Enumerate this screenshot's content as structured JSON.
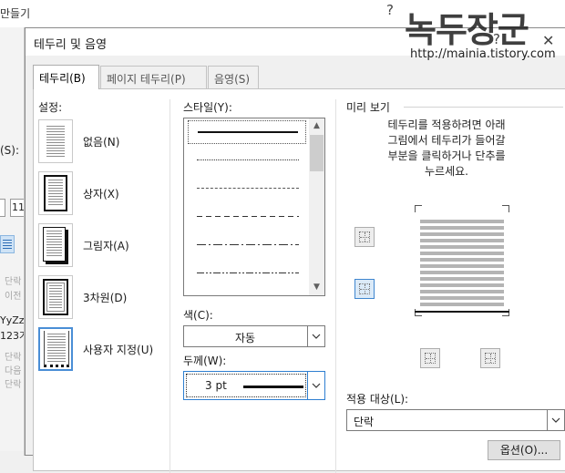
{
  "background": {
    "title": "만들기",
    "help": "?",
    "label_s": "(S):",
    "box_text": "11",
    "faint_lines": [
      "단락",
      "이전",
      "YyZz",
      "123가",
      "단락",
      "다음",
      "단락"
    ]
  },
  "watermark": {
    "title": "녹두장군",
    "url": "http://mainia.tistory.com"
  },
  "dialog": {
    "title": "테두리 및 음영",
    "help": "?",
    "close": "✕",
    "tabs": [
      {
        "label": "테두리(B)",
        "active": true
      },
      {
        "label": "페이지 테두리(P)",
        "active": false
      },
      {
        "label": "음영(S)",
        "active": false
      }
    ],
    "setting": {
      "label": "설정:",
      "items": [
        {
          "label": "없음(N)"
        },
        {
          "label": "상자(X)"
        },
        {
          "label": "그림자(A)"
        },
        {
          "label": "3차원(D)"
        },
        {
          "label": "사용자 지정(U)",
          "selected": true
        }
      ]
    },
    "style": {
      "label": "스타일(Y):",
      "lines": [
        "solid",
        "dotted",
        "dashed-fine",
        "dashed",
        "dash-dot",
        "dash-dot-dot"
      ]
    },
    "color": {
      "label": "색(C):",
      "value": "자동"
    },
    "width": {
      "label": "두께(W):",
      "value": "3 pt"
    },
    "preview": {
      "label": "미리 보기",
      "instructions": "테두리를 적용하려면 아래\n그림에서 테두리가 들어갈\n부분을 클릭하거나 단추를\n누르세요."
    },
    "apply_to": {
      "label": "적용 대상(L):",
      "value": "단락"
    },
    "options_button": "옵션(O)..."
  },
  "colors": {
    "accent": "#2f7fd1",
    "dialog_bg": "#f0f0f0",
    "panel_bg": "#ffffff"
  }
}
